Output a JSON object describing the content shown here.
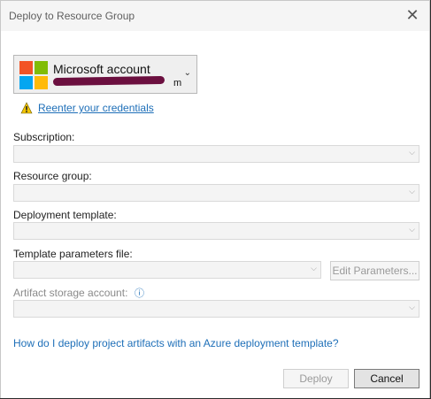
{
  "window": {
    "title": "Deploy to Resource Group",
    "close_glyph": "✕"
  },
  "account": {
    "name": "Microsoft account",
    "email_visible_tail": "m",
    "logo_colors": [
      "#f35325",
      "#81bc06",
      "#05a6f0",
      "#ffba08"
    ],
    "chevron": "⌄"
  },
  "credentials": {
    "warning_icon": "warning-icon",
    "link_label": "Reenter your credentials"
  },
  "fields": {
    "subscription_label": "Subscription:",
    "resource_group_label": "Resource group:",
    "deployment_template_label": "Deployment template:",
    "template_parameters_label": "Template parameters file:",
    "edit_parameters_label": "Edit Parameters...",
    "artifact_storage_label": "Artifact storage account:",
    "info_glyph": "ⓘ",
    "dropdown_glyph": "⌵"
  },
  "help": {
    "link_label": "How do I deploy project artifacts with an Azure deployment template?"
  },
  "footer": {
    "deploy_label": "Deploy",
    "cancel_label": "Cancel"
  },
  "colors": {
    "link": "#1e6fb8",
    "redaction": "#6b0f3f"
  }
}
